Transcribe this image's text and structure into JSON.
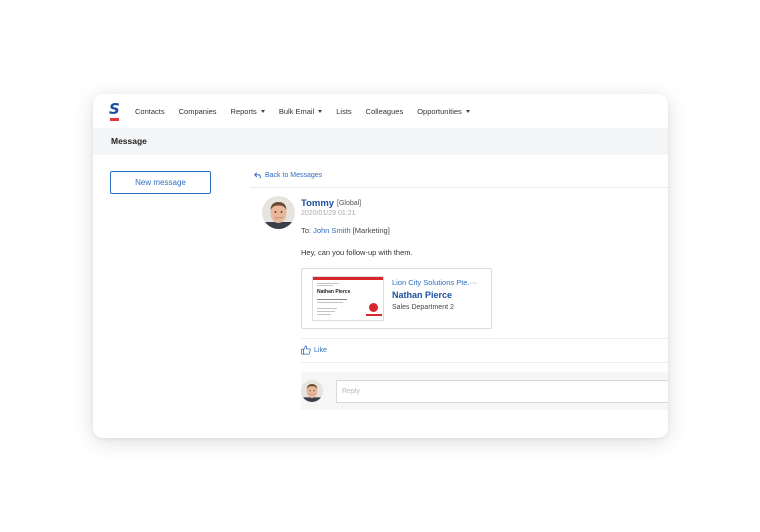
{
  "nav": {
    "logo_letter": "S",
    "items": [
      {
        "label": "Contacts",
        "dropdown": false
      },
      {
        "label": "Companies",
        "dropdown": false
      },
      {
        "label": "Reports",
        "dropdown": true
      },
      {
        "label": "Bulk Email",
        "dropdown": true
      },
      {
        "label": "Lists",
        "dropdown": false
      },
      {
        "label": "Colleagues",
        "dropdown": false
      },
      {
        "label": "Opportunities",
        "dropdown": true
      }
    ]
  },
  "page": {
    "title": "Message"
  },
  "sidebar": {
    "new_message_label": "New message"
  },
  "message": {
    "back_label": "Back to Messages",
    "sender": "Tommy",
    "sender_scope": "[Global]",
    "timestamp": "2020/01/29 01:21",
    "to_prefix": "To: ",
    "to_name": "John Smith",
    "to_scope": " [Marketing]",
    "body": "Hey, can you follow-up with them.",
    "attachment": {
      "company": "Lion City Solutions Pte.···",
      "name": "Nathan Pierce",
      "department": "Sales Department 2",
      "card_name": "Nathan Pierce"
    },
    "like_label": "Like",
    "reply_placeholder": "Reply"
  },
  "colors": {
    "accent": "#2f6fc2",
    "brand_blue": "#1d4fa0",
    "brand_red": "#e23a3a"
  }
}
